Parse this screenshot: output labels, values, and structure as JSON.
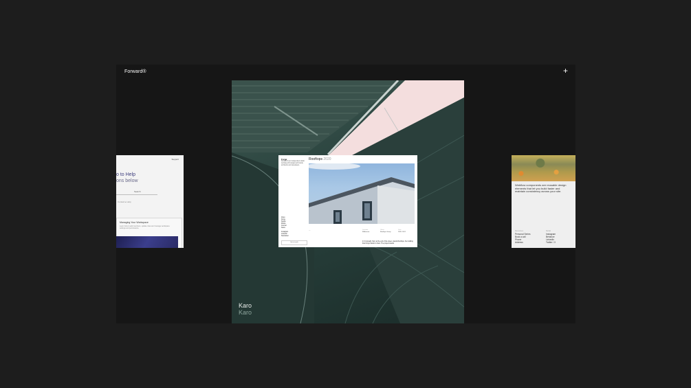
{
  "app": {
    "logo": "Forward®",
    "plus": "+"
  },
  "left_card": {
    "top_link": "Support",
    "heading_1": "o to Help",
    "heading_2": "ons below",
    "button": "Search",
    "meta": "Contact ▸ Help",
    "box_title": "Managing Your Workspace",
    "box_text": "Learn how to add members, update roles and manage workspace settings and permissions."
  },
  "cover": {
    "title": "Karo",
    "subtitle": "Karo"
  },
  "popup": {
    "brand": "Forge",
    "description": "Forward is an independent studio working with design-led brands, architects and developers.",
    "side_list": [
      "Index",
      "Forge",
      "Studio",
      "Works",
      "Journal",
      "News",
      "",
      "Instagram",
      "LinkedIn",
      "Newsletter"
    ],
    "side_button": "Get in touch",
    "title": "Rooftops",
    "year": "2020",
    "dash": "—",
    "meta": [
      {
        "label": "Location",
        "value": "Melbourne"
      },
      {
        "label": "Client",
        "value": "Rooftops Group"
      },
      {
        "label": "Year",
        "value": "2020–2021"
      }
    ],
    "body_text": "In Cromwells Yard, at the end of the street, stands Rooftops, the building that brings Studio to Karo. The project stands"
  },
  "right_card": {
    "text": "Webflow components are reusable design elements that let you build faster and maintain consistency across your site.",
    "col1_label": "Resources",
    "col1": [
      "Personal Series",
      "Book a call",
      "Phone",
      "Address"
    ],
    "col2_label": "Social",
    "col2": [
      "Instagram",
      "Behance",
      "LinkedIn",
      "Twitter / X"
    ]
  }
}
